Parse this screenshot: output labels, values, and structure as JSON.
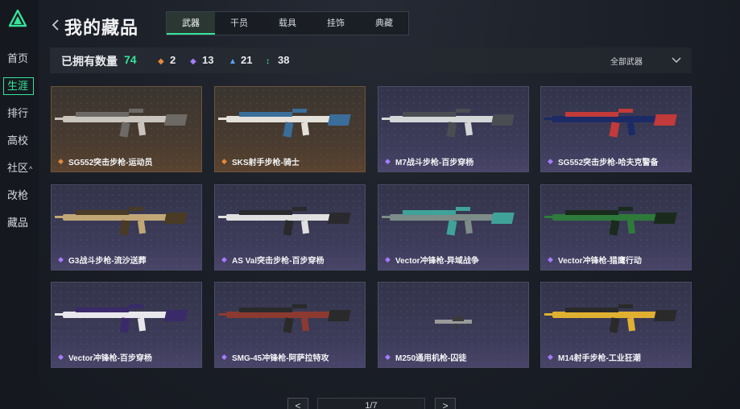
{
  "sidebar": {
    "items": [
      {
        "label": "首页"
      },
      {
        "label": "生涯"
      },
      {
        "label": "排行"
      },
      {
        "label": "高校"
      },
      {
        "label": "社区",
        "caret": "^"
      },
      {
        "label": "改枪"
      },
      {
        "label": "藏品"
      }
    ],
    "active_index": 1
  },
  "header": {
    "title": "我的藏品",
    "tabs": [
      {
        "label": "武器"
      },
      {
        "label": "干员"
      },
      {
        "label": "载具"
      },
      {
        "label": "挂饰"
      },
      {
        "label": "典藏"
      }
    ],
    "active_tab": 0
  },
  "stats": {
    "owned_label": "已拥有数量",
    "owned_count": "74",
    "counts": [
      {
        "icon": "orange-diamond-icon",
        "value": "2",
        "color": "#e08a3c"
      },
      {
        "icon": "purple-diamond-icon",
        "value": "13",
        "color": "#a77bff"
      },
      {
        "icon": "blue-chevron-icon",
        "value": "21",
        "color": "#5aa6ff"
      },
      {
        "icon": "green-arrows-icon",
        "value": "38",
        "color": "#35e39a"
      }
    ],
    "filter_value": "全部武器"
  },
  "colors": {
    "accent": "#35e39a",
    "legendary": "#e08a3c",
    "epic": "#a77bff"
  },
  "cards": [
    {
      "name": "SG552突击步枪-运动员",
      "rarity": "orange"
    },
    {
      "name": "SKS射手步枪-骑士",
      "rarity": "orange"
    },
    {
      "name": "M7战斗步枪-百步穿杨",
      "rarity": "purple"
    },
    {
      "name": "SG552突击步枪-哈夫克警备",
      "rarity": "purple"
    },
    {
      "name": "G3战斗步枪-流沙送葬",
      "rarity": "purple"
    },
    {
      "name": "AS Val突击步枪-百步穿杨",
      "rarity": "purple"
    },
    {
      "name": "Vector冲锋枪-异域战争",
      "rarity": "purple"
    },
    {
      "name": "Vector冲锋枪-猎鹰行动",
      "rarity": "purple"
    },
    {
      "name": "Vector冲锋枪-百步穿杨",
      "rarity": "purple"
    },
    {
      "name": "SMG-45冲锋枪-阿萨拉特攻",
      "rarity": "purple"
    },
    {
      "name": "M250通用机枪-囚徒",
      "rarity": "purple"
    },
    {
      "name": "M14射手步枪-工业狂潮",
      "rarity": "purple"
    }
  ],
  "pagination": {
    "prev": "<",
    "page_text": "1/7",
    "next": ">"
  }
}
